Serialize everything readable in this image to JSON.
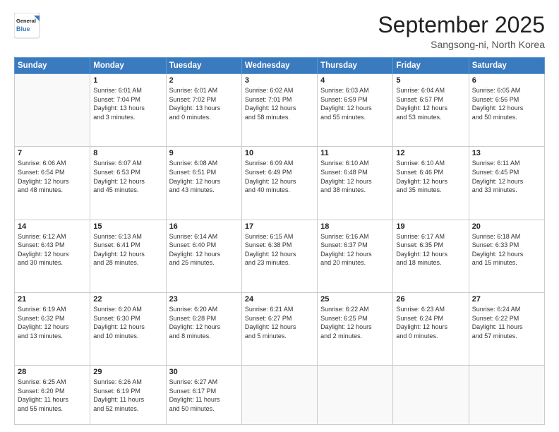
{
  "header": {
    "logo_line1": "General",
    "logo_line2": "Blue",
    "month": "September 2025",
    "location": "Sangsong-ni, North Korea"
  },
  "weekdays": [
    "Sunday",
    "Monday",
    "Tuesday",
    "Wednesday",
    "Thursday",
    "Friday",
    "Saturday"
  ],
  "weeks": [
    [
      {
        "day": "",
        "info": ""
      },
      {
        "day": "1",
        "info": "Sunrise: 6:01 AM\nSunset: 7:04 PM\nDaylight: 13 hours\nand 3 minutes."
      },
      {
        "day": "2",
        "info": "Sunrise: 6:01 AM\nSunset: 7:02 PM\nDaylight: 13 hours\nand 0 minutes."
      },
      {
        "day": "3",
        "info": "Sunrise: 6:02 AM\nSunset: 7:01 PM\nDaylight: 12 hours\nand 58 minutes."
      },
      {
        "day": "4",
        "info": "Sunrise: 6:03 AM\nSunset: 6:59 PM\nDaylight: 12 hours\nand 55 minutes."
      },
      {
        "day": "5",
        "info": "Sunrise: 6:04 AM\nSunset: 6:57 PM\nDaylight: 12 hours\nand 53 minutes."
      },
      {
        "day": "6",
        "info": "Sunrise: 6:05 AM\nSunset: 6:56 PM\nDaylight: 12 hours\nand 50 minutes."
      }
    ],
    [
      {
        "day": "7",
        "info": "Sunrise: 6:06 AM\nSunset: 6:54 PM\nDaylight: 12 hours\nand 48 minutes."
      },
      {
        "day": "8",
        "info": "Sunrise: 6:07 AM\nSunset: 6:53 PM\nDaylight: 12 hours\nand 45 minutes."
      },
      {
        "day": "9",
        "info": "Sunrise: 6:08 AM\nSunset: 6:51 PM\nDaylight: 12 hours\nand 43 minutes."
      },
      {
        "day": "10",
        "info": "Sunrise: 6:09 AM\nSunset: 6:49 PM\nDaylight: 12 hours\nand 40 minutes."
      },
      {
        "day": "11",
        "info": "Sunrise: 6:10 AM\nSunset: 6:48 PM\nDaylight: 12 hours\nand 38 minutes."
      },
      {
        "day": "12",
        "info": "Sunrise: 6:10 AM\nSunset: 6:46 PM\nDaylight: 12 hours\nand 35 minutes."
      },
      {
        "day": "13",
        "info": "Sunrise: 6:11 AM\nSunset: 6:45 PM\nDaylight: 12 hours\nand 33 minutes."
      }
    ],
    [
      {
        "day": "14",
        "info": "Sunrise: 6:12 AM\nSunset: 6:43 PM\nDaylight: 12 hours\nand 30 minutes."
      },
      {
        "day": "15",
        "info": "Sunrise: 6:13 AM\nSunset: 6:41 PM\nDaylight: 12 hours\nand 28 minutes."
      },
      {
        "day": "16",
        "info": "Sunrise: 6:14 AM\nSunset: 6:40 PM\nDaylight: 12 hours\nand 25 minutes."
      },
      {
        "day": "17",
        "info": "Sunrise: 6:15 AM\nSunset: 6:38 PM\nDaylight: 12 hours\nand 23 minutes."
      },
      {
        "day": "18",
        "info": "Sunrise: 6:16 AM\nSunset: 6:37 PM\nDaylight: 12 hours\nand 20 minutes."
      },
      {
        "day": "19",
        "info": "Sunrise: 6:17 AM\nSunset: 6:35 PM\nDaylight: 12 hours\nand 18 minutes."
      },
      {
        "day": "20",
        "info": "Sunrise: 6:18 AM\nSunset: 6:33 PM\nDaylight: 12 hours\nand 15 minutes."
      }
    ],
    [
      {
        "day": "21",
        "info": "Sunrise: 6:19 AM\nSunset: 6:32 PM\nDaylight: 12 hours\nand 13 minutes."
      },
      {
        "day": "22",
        "info": "Sunrise: 6:20 AM\nSunset: 6:30 PM\nDaylight: 12 hours\nand 10 minutes."
      },
      {
        "day": "23",
        "info": "Sunrise: 6:20 AM\nSunset: 6:28 PM\nDaylight: 12 hours\nand 8 minutes."
      },
      {
        "day": "24",
        "info": "Sunrise: 6:21 AM\nSunset: 6:27 PM\nDaylight: 12 hours\nand 5 minutes."
      },
      {
        "day": "25",
        "info": "Sunrise: 6:22 AM\nSunset: 6:25 PM\nDaylight: 12 hours\nand 2 minutes."
      },
      {
        "day": "26",
        "info": "Sunrise: 6:23 AM\nSunset: 6:24 PM\nDaylight: 12 hours\nand 0 minutes."
      },
      {
        "day": "27",
        "info": "Sunrise: 6:24 AM\nSunset: 6:22 PM\nDaylight: 11 hours\nand 57 minutes."
      }
    ],
    [
      {
        "day": "28",
        "info": "Sunrise: 6:25 AM\nSunset: 6:20 PM\nDaylight: 11 hours\nand 55 minutes."
      },
      {
        "day": "29",
        "info": "Sunrise: 6:26 AM\nSunset: 6:19 PM\nDaylight: 11 hours\nand 52 minutes."
      },
      {
        "day": "30",
        "info": "Sunrise: 6:27 AM\nSunset: 6:17 PM\nDaylight: 11 hours\nand 50 minutes."
      },
      {
        "day": "",
        "info": ""
      },
      {
        "day": "",
        "info": ""
      },
      {
        "day": "",
        "info": ""
      },
      {
        "day": "",
        "info": ""
      }
    ]
  ]
}
